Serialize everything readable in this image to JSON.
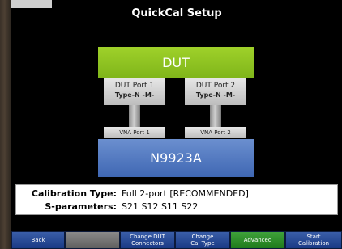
{
  "title": "QuickCal Setup",
  "diagram": {
    "dut_label": "DUT",
    "dut_ports": [
      {
        "name": "DUT Port 1",
        "type": "Type-N -M-"
      },
      {
        "name": "DUT Port 2",
        "type": "Type-N -M-"
      }
    ],
    "vna_ports": [
      "VNA Port 1",
      "VNA Port 2"
    ],
    "vna_label": "N9923A"
  },
  "info": {
    "calibration_type_label": "Calibration Type:",
    "calibration_type_value": "Full 2-port [RECOMMENDED]",
    "sparams_label": "S-parameters:",
    "sparams_value": "S21 S12 S11 S22"
  },
  "softkeys": {
    "back": "Back",
    "blank": "",
    "change_dut_connectors": "Change DUT\nConnectors",
    "change_cal_type": "Change\nCal Type",
    "advanced": "Advanced",
    "start_calibration": "Start\nCalibration"
  }
}
